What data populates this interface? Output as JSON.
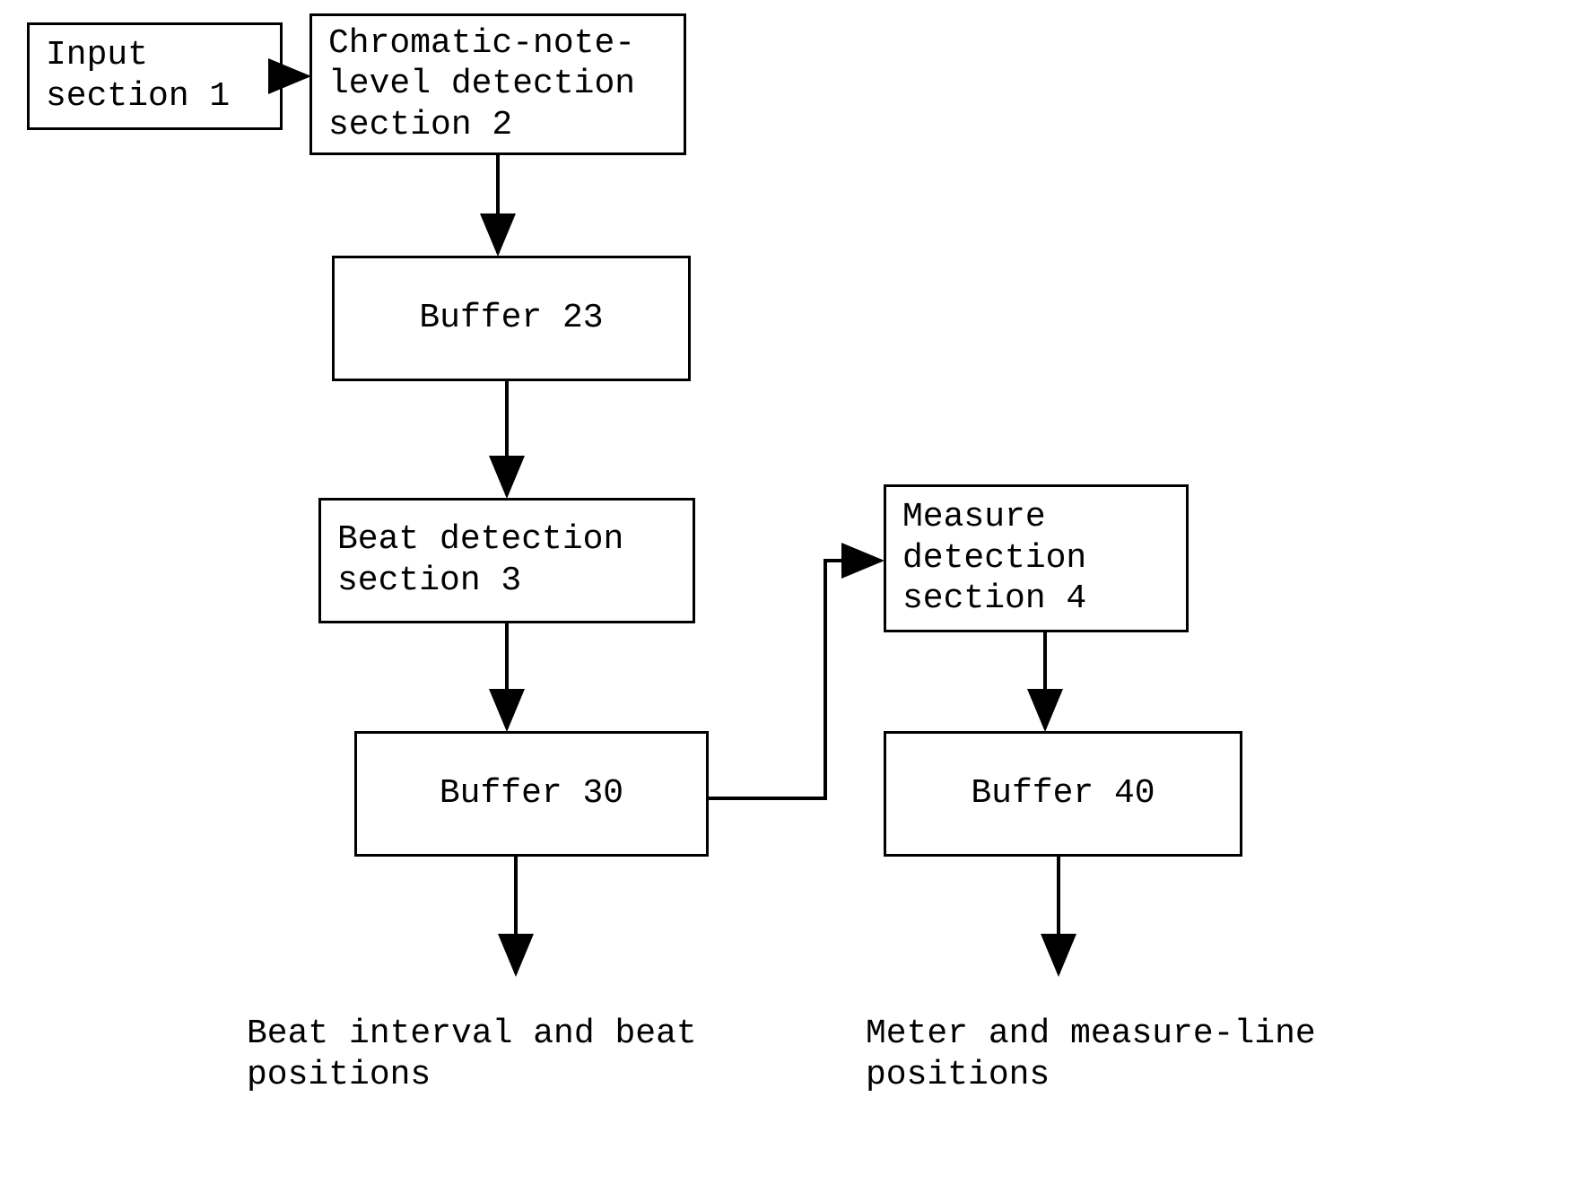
{
  "chart_data": {
    "type": "flowchart",
    "nodes": [
      {
        "id": "input",
        "label": "Input\nsection 1"
      },
      {
        "id": "chromatic",
        "label": "Chromatic-note-\nlevel detection\nsection 2"
      },
      {
        "id": "buffer23",
        "label": "Buffer 23"
      },
      {
        "id": "beat",
        "label": "Beat detection\nsection 3"
      },
      {
        "id": "buffer30",
        "label": "Buffer 30"
      },
      {
        "id": "measure",
        "label": "Measure\ndetection\nsection 4"
      },
      {
        "id": "buffer40",
        "label": "Buffer 40"
      }
    ],
    "edges": [
      {
        "from": "input",
        "to": "chromatic"
      },
      {
        "from": "chromatic",
        "to": "buffer23"
      },
      {
        "from": "buffer23",
        "to": "beat"
      },
      {
        "from": "beat",
        "to": "buffer30"
      },
      {
        "from": "buffer30",
        "to": "measure"
      },
      {
        "from": "measure",
        "to": "buffer40"
      }
    ],
    "outputs": [
      {
        "from": "buffer30",
        "label": "Beat interval and beat\npositions"
      },
      {
        "from": "buffer40",
        "label": "Meter and measure-line\npositions"
      }
    ]
  },
  "boxes": {
    "input": "Input\nsection 1",
    "chromatic": "Chromatic-note-\nlevel detection\nsection 2",
    "buffer23": "Buffer 23",
    "beat": "Beat detection\nsection 3",
    "buffer30": "Buffer 30",
    "measure": "Measure\ndetection\nsection 4",
    "buffer40": "Buffer 40"
  },
  "labels": {
    "beat_output": "Beat interval and beat\npositions",
    "meter_output": "Meter and measure-line\npositions"
  }
}
